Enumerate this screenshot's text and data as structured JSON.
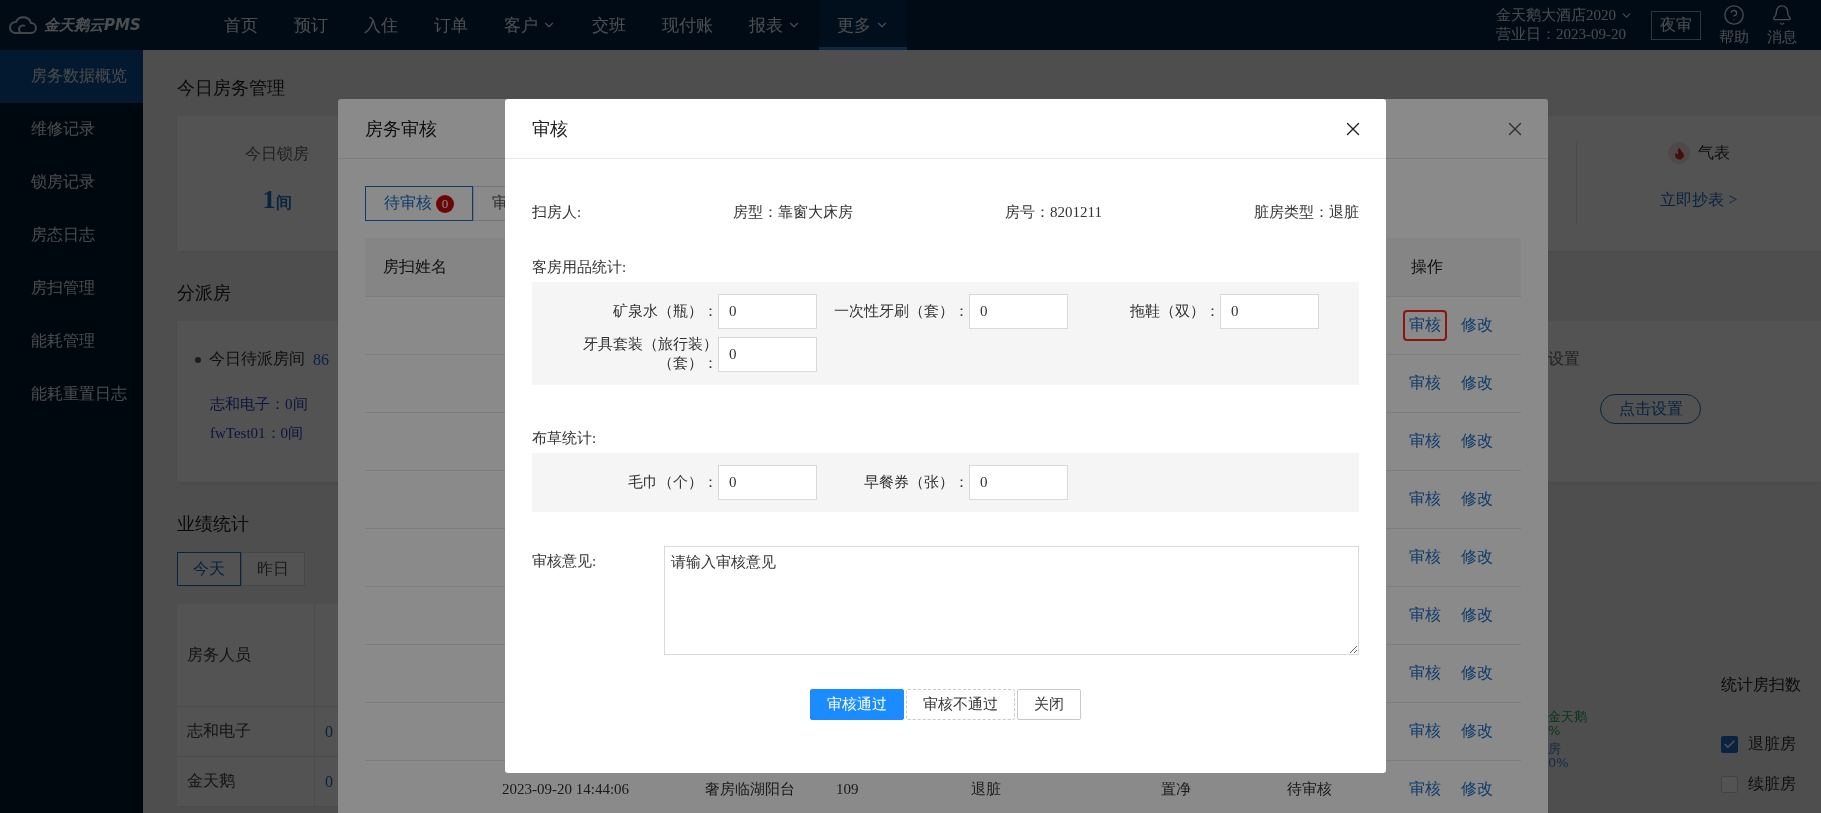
{
  "topbar": {
    "logo": "金天鹅云PMS",
    "nav": [
      {
        "label": "首页",
        "dropdown": false,
        "selected": false
      },
      {
        "label": "预订",
        "dropdown": false,
        "selected": false
      },
      {
        "label": "入住",
        "dropdown": false,
        "selected": false
      },
      {
        "label": "订单",
        "dropdown": false,
        "selected": false
      },
      {
        "label": "客户",
        "dropdown": true,
        "selected": false
      },
      {
        "label": "交班",
        "dropdown": false,
        "selected": false
      },
      {
        "label": "现付账",
        "dropdown": false,
        "selected": false
      },
      {
        "label": "报表",
        "dropdown": true,
        "selected": false
      },
      {
        "label": "更多",
        "dropdown": true,
        "selected": true
      }
    ],
    "hotel": "金天鹅大酒店2020",
    "business_date": "营业日：2023-09-20",
    "night_audit": "夜审",
    "help": "帮助",
    "messages": "消息"
  },
  "sidebar": {
    "items": [
      {
        "label": "房务数据概览",
        "selected": true
      },
      {
        "label": "维修记录",
        "selected": false
      },
      {
        "label": "锁房记录",
        "selected": false
      },
      {
        "label": "房态日志",
        "selected": false
      },
      {
        "label": "房扫管理",
        "selected": false
      },
      {
        "label": "能耗管理",
        "selected": false
      },
      {
        "label": "能耗重置日志",
        "selected": false
      }
    ]
  },
  "dashboard": {
    "today": {
      "title": "今日房务管理",
      "locked_label": "今日锁房",
      "locked_value": "1",
      "locked_unit": "间",
      "meter_label": "气表",
      "meter_link": "立即抄表 >"
    },
    "dispatch": {
      "title": "分派房",
      "pending_text": "今日待派房间",
      "pending_count": "86",
      "staff": [
        "志和电子：0间",
        "fwTest01：0间"
      ],
      "settings_text": "设置",
      "settings_button": "点击设置"
    },
    "performance": {
      "title": "业绩统计",
      "tabs": [
        {
          "label": "今天",
          "selected": true
        },
        {
          "label": "昨日",
          "selected": false
        }
      ],
      "header": "房务人员",
      "rows": [
        {
          "name": "志和电子",
          "value": "0"
        },
        {
          "name": "金天鹅",
          "value": "0"
        }
      ],
      "legend": [
        {
          "label": "金天鹅",
          "value": "%"
        },
        {
          "label": "房",
          "value": "0%"
        }
      ],
      "stats_title": "统计房扫数",
      "filters": [
        {
          "label": "退脏房",
          "checked": true
        },
        {
          "label": "续脏房",
          "checked": false
        }
      ]
    }
  },
  "review_list_modal": {
    "title": "房务审核",
    "tabs": [
      {
        "label": "待审核",
        "badge": "0",
        "selected": true
      },
      {
        "label": "审",
        "selected": false
      }
    ],
    "columns": {
      "name": "房扫姓名",
      "actions": "操作"
    },
    "rows": [
      {
        "actions": [
          "审核",
          "修改"
        ],
        "highlighted": true
      },
      {
        "actions": [
          "审核",
          "修改"
        ],
        "highlighted": false
      },
      {
        "actions": [
          "审核",
          "修改"
        ],
        "highlighted": false
      },
      {
        "actions": [
          "审核",
          "修改"
        ],
        "highlighted": false
      },
      {
        "actions": [
          "审核",
          "修改"
        ],
        "highlighted": false
      },
      {
        "actions": [
          "审核",
          "修改"
        ],
        "highlighted": false
      },
      {
        "actions": [
          "审核",
          "修改"
        ],
        "highlighted": false
      },
      {
        "actions": [
          "审核",
          "修改"
        ],
        "highlighted": false
      },
      {
        "cells": [
          "2023-09-20 14:44:06",
          "奢房临湖阳台",
          "109",
          "退脏",
          "置净",
          "待审核"
        ],
        "actions": [
          "审核",
          "修改"
        ],
        "highlighted": false
      }
    ]
  },
  "review_modal": {
    "title": "审核",
    "info": [
      "扫房人:",
      "房型：靠窗大床房",
      "房号：8201211",
      "脏房类型：退脏"
    ],
    "sections": [
      {
        "title": "客房用品统计:",
        "fields": [
          {
            "label": "矿泉水（瓶）：",
            "value": "0"
          },
          {
            "label": "一次性牙刷（套）：",
            "value": "0"
          },
          {
            "label": "拖鞋（双）：",
            "value": "0"
          },
          {
            "label": "牙具套装（旅行装）（套）：",
            "value": "0"
          }
        ]
      },
      {
        "title": "布草统计:",
        "fields": [
          {
            "label": "毛巾（个）：",
            "value": "0"
          },
          {
            "label": "早餐券（张）：",
            "value": "0"
          }
        ]
      }
    ],
    "comment": {
      "label": "审核意见:",
      "placeholder": "请输入审核意见"
    },
    "buttons": [
      {
        "label": "审核通过",
        "kind": "primary"
      },
      {
        "label": "审核不通过",
        "kind": "dashed"
      },
      {
        "label": "关闭",
        "kind": "default"
      }
    ]
  }
}
